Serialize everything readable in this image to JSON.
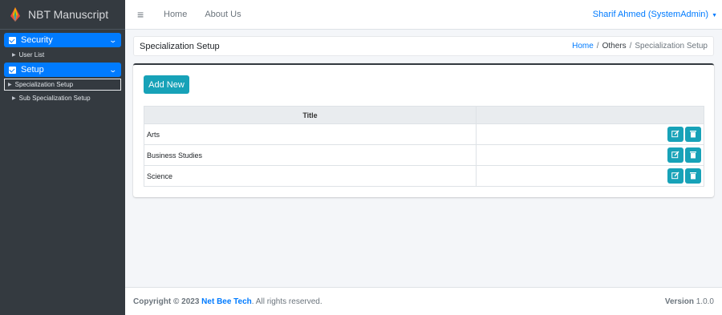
{
  "brand": {
    "name": "NBT Manuscript",
    "logo_icon": "feather-logo-icon"
  },
  "sidebar": {
    "groups": [
      {
        "label": "Security",
        "items": [
          {
            "label": "User List"
          }
        ]
      },
      {
        "label": "Setup",
        "items": [
          {
            "label": "Specialization Setup",
            "active": true
          },
          {
            "label": "Sub Specialization Setup"
          }
        ]
      }
    ]
  },
  "topbar": {
    "menu_icon": "≡",
    "links": [
      "Home",
      "About Us"
    ],
    "user": "Sharif Ahmed (SystemAdmin)"
  },
  "page": {
    "title": "Specialization Setup",
    "breadcrumb": [
      "Home",
      "Others",
      "Specialization Setup"
    ]
  },
  "actions": {
    "add_label": "Add New"
  },
  "table": {
    "headers": [
      "Title",
      ""
    ],
    "rows": [
      {
        "title": "Arts"
      },
      {
        "title": "Business Studies"
      },
      {
        "title": "Science"
      }
    ]
  },
  "footer": {
    "copyright_prefix": "Copyright © 2023 ",
    "company": "Net Bee Tech",
    "copyright_suffix": ". All rights reserved.",
    "version_label": "Version",
    "version_value": "1.0.0"
  },
  "colors": {
    "primary": "#007bff",
    "info": "#17a2b8",
    "sidebar": "#343a40"
  }
}
